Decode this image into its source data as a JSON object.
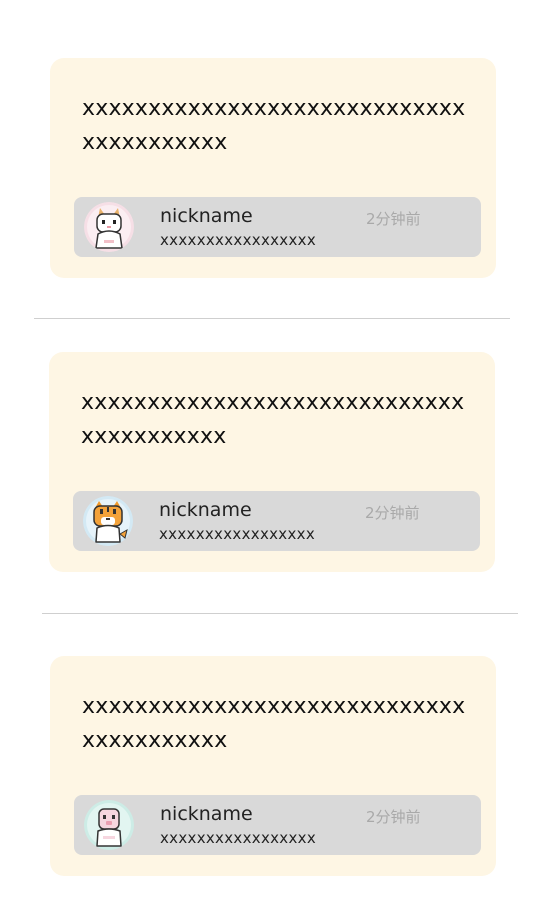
{
  "posts": [
    {
      "content": "xxxxxxxxxxxxxxxxxxxxxxxxxxxxxxxxxxxxxxxx",
      "nickname": "nickname",
      "description": "xxxxxxxxxxxxxxxxx",
      "time": "2分钟前",
      "avatar": "white-dragon-avatar-icon"
    },
    {
      "content": "xxxxxxxxxxxxxxxxxxxxxxxxxxxxxxxxxxxxxxxx",
      "nickname": "nickname",
      "description": "xxxxxxxxxxxxxxxxx",
      "time": "2分钟前",
      "avatar": "orange-tiger-avatar-icon"
    },
    {
      "content": "xxxxxxxxxxxxxxxxxxxxxxxxxxxxxxxxxxxxxxxx",
      "nickname": "nickname",
      "description": "xxxxxxxxxxxxxxxxx",
      "time": "2分钟前",
      "avatar": "pink-pig-avatar-icon"
    }
  ]
}
